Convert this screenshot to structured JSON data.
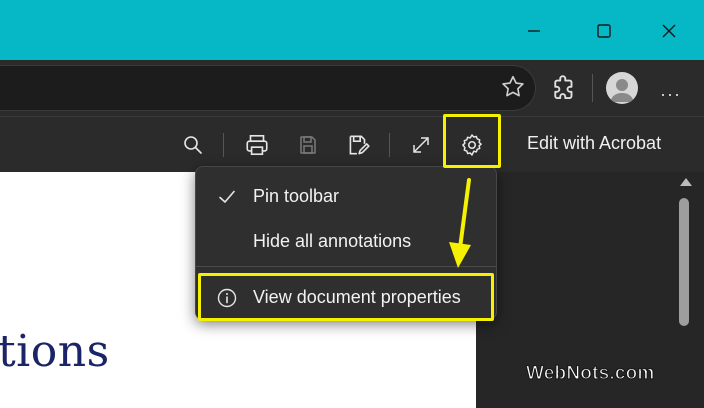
{
  "window": {
    "controls": [
      "minimize",
      "maximize",
      "close"
    ],
    "accent_color": "#06b7c5"
  },
  "address_bar": {
    "favorite_icon": "star-icon",
    "extensions_icon": "puzzle-icon",
    "profile_icon": "avatar",
    "more_label": "···"
  },
  "pdf_toolbar": {
    "icons": [
      "search-icon",
      "print-icon",
      "save-icon",
      "save-as-icon",
      "fullscreen-icon",
      "gear-icon"
    ],
    "edit_label": "Edit with Acrobat"
  },
  "settings_menu": {
    "items": [
      {
        "label": "Pin toolbar",
        "checked": true,
        "icon": "check-icon"
      },
      {
        "label": "Hide all annotations",
        "checked": false
      },
      {
        "label": "View document properties",
        "icon": "info-icon"
      }
    ]
  },
  "document": {
    "visible_text": "tions"
  },
  "annotations": {
    "highlight_color": "#f5f100",
    "watermark": "WebNots.com"
  }
}
